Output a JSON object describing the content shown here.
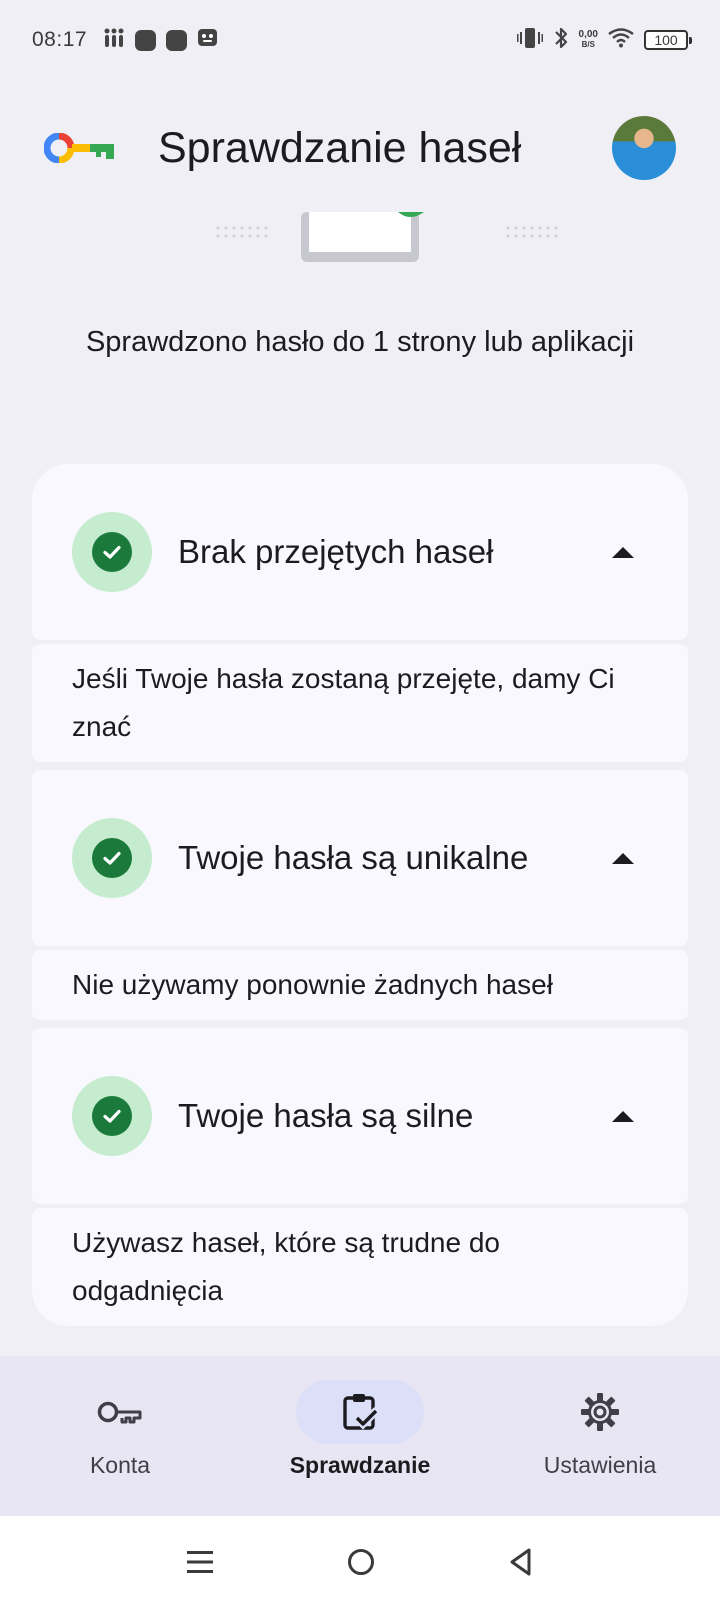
{
  "status_bar": {
    "time": "08:17",
    "net_speed_value": "0,00",
    "net_speed_unit": "B/S",
    "battery": "100"
  },
  "header": {
    "title": "Sprawdzanie haseł"
  },
  "summary": {
    "text": "Sprawdzono hasło do 1 strony lub aplikacji"
  },
  "cards": [
    {
      "title": "Brak przejętych haseł",
      "body": "Jeśli Twoje hasła zostaną przejęte, damy Ci znać"
    },
    {
      "title": "Twoje hasła są unikalne",
      "body": "Nie używamy ponownie żadnych haseł"
    },
    {
      "title": "Twoje hasła są silne",
      "body": "Używasz haseł, które są trudne do odgadnięcia"
    }
  ],
  "bottom_nav": {
    "items": [
      {
        "label": "Konta",
        "icon": "key-icon",
        "active": false
      },
      {
        "label": "Sprawdzanie",
        "icon": "clipboard-check-icon",
        "active": true
      },
      {
        "label": "Ustawienia",
        "icon": "gear-icon",
        "active": false
      }
    ]
  },
  "colors": {
    "accent_green": "#1b7a3b",
    "check_bg": "#c5eccf",
    "card_bg": "#faf8ff",
    "nav_bg": "#e9e6f3",
    "nav_active_bg": "#dcdff8"
  }
}
